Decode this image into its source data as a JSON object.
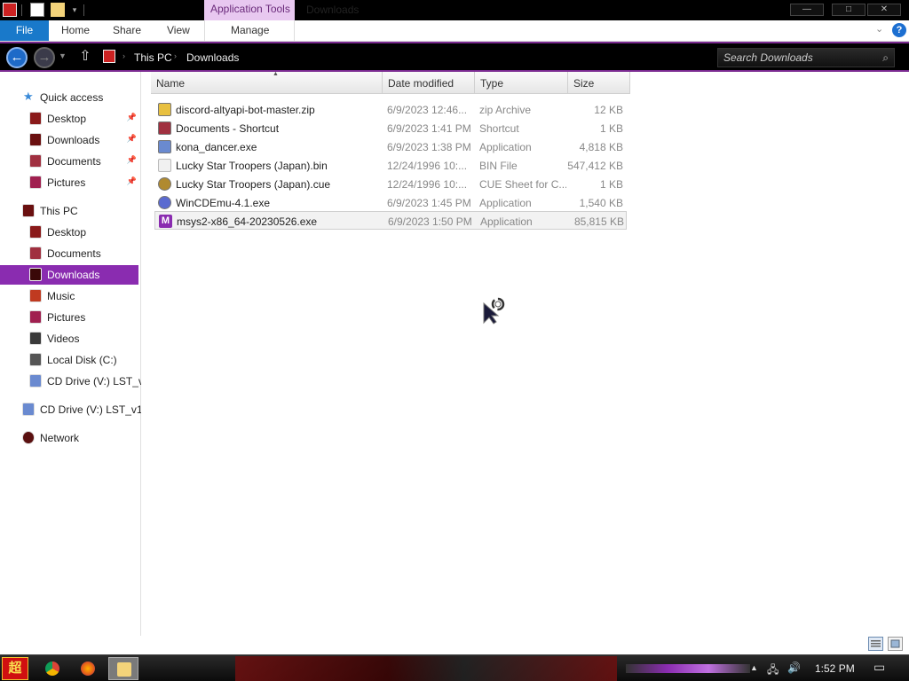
{
  "titlebar": {
    "context_tab": "Application Tools",
    "window_title": "Downloads",
    "controls": {
      "minimize": "—",
      "maximize": "□",
      "close": "✕"
    }
  },
  "ribbon": {
    "tabs": [
      "File",
      "Home",
      "Share",
      "View",
      "Manage"
    ],
    "expand_glyph": "⌄",
    "help_glyph": "?"
  },
  "address": {
    "crumbs": [
      "This PC",
      "Downloads"
    ],
    "search_placeholder": "Search Downloads"
  },
  "nav": {
    "quick_access": "Quick access",
    "quick_items": [
      "Desktop",
      "Downloads",
      "Documents",
      "Pictures"
    ],
    "this_pc": "This PC",
    "pc_items": [
      "Desktop",
      "Documents",
      "Downloads",
      "Music",
      "Pictures",
      "Videos",
      "Local Disk (C:)",
      "CD Drive (V:) LST_v"
    ],
    "cd_drive": "CD Drive (V:) LST_v1",
    "network": "Network",
    "selected": "Downloads"
  },
  "columns": [
    "Name",
    "Date modified",
    "Type",
    "Size"
  ],
  "files": [
    {
      "name": "discord-altyapi-bot-master.zip",
      "date": "6/9/2023 12:46...",
      "type": "zip Archive",
      "size": "12 KB",
      "icon": "zip-icon",
      "color": "#e8c040"
    },
    {
      "name": "Documents - Shortcut",
      "date": "6/9/2023 1:41 PM",
      "type": "Shortcut",
      "size": "1 KB",
      "icon": "shortcut-icon",
      "color": "#a03040"
    },
    {
      "name": "kona_dancer.exe",
      "date": "6/9/2023 1:38 PM",
      "type": "Application",
      "size": "4,818 KB",
      "icon": "anime-app-icon",
      "color": "#6a8ad0"
    },
    {
      "name": "Lucky Star Troopers (Japan).bin",
      "date": "12/24/1996 10:...",
      "type": "BIN File",
      "size": "547,412 KB",
      "icon": "blank-file-icon",
      "color": "#e8e8e8"
    },
    {
      "name": "Lucky Star Troopers (Japan).cue",
      "date": "12/24/1996 10:...",
      "type": "CUE Sheet for C...",
      "size": "1 KB",
      "icon": "disc-image-icon",
      "color": "#b08a30"
    },
    {
      "name": "WinCDEmu-4.1.exe",
      "date": "6/9/2023 1:45 PM",
      "type": "Application",
      "size": "1,540 KB",
      "icon": "wincdemu-icon",
      "color": "#5a6ad0"
    },
    {
      "name": "msys2-x86_64-20230526.exe",
      "date": "6/9/2023 1:50 PM",
      "type": "Application",
      "size": "85,815 KB",
      "icon": "msys2-icon",
      "color": "#8a2cb0"
    }
  ],
  "selected_file": "msys2-x86_64-20230526.exe",
  "taskbar": {
    "start_glyph": "超",
    "clock": "1:52 PM"
  },
  "colors": {
    "accent": "#8a2cb0",
    "file_tab": "#1979ca",
    "context_tab": "#e8c8f0"
  }
}
